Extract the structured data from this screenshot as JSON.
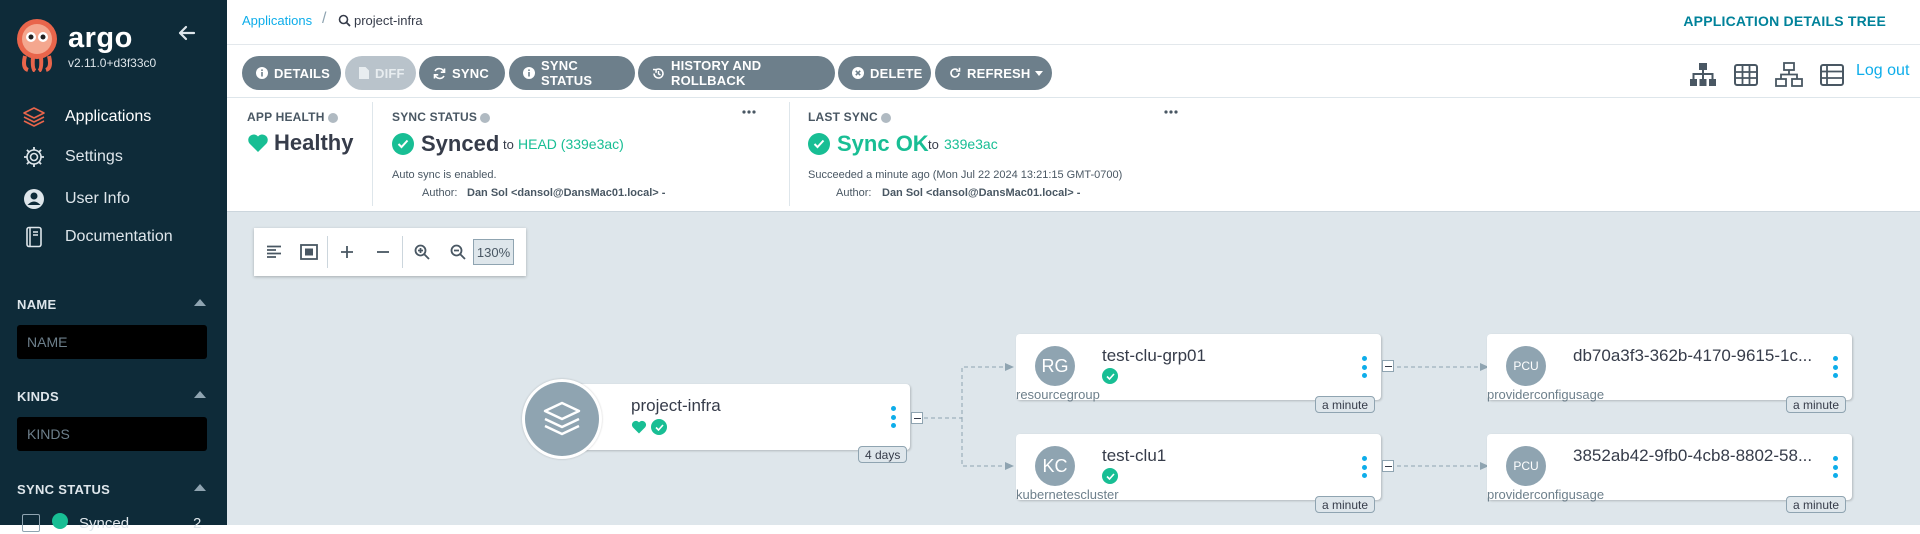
{
  "sidebar": {
    "brand": "argo",
    "version": "v2.11.0+d3f33c0",
    "nav": [
      {
        "label": "Applications",
        "icon": "layers-icon"
      },
      {
        "label": "Settings",
        "icon": "gear-icon"
      },
      {
        "label": "User Info",
        "icon": "user-icon"
      },
      {
        "label": "Documentation",
        "icon": "book-icon"
      }
    ],
    "filters": {
      "name_label": "NAME",
      "name_placeholder": "NAME",
      "kinds_label": "KINDS",
      "kinds_placeholder": "KINDS",
      "sync_status_label": "SYNC STATUS",
      "synced_label": "Synced",
      "synced_count": "2"
    }
  },
  "topbar": {
    "crumb_root": "Applications",
    "crumb_app": "project-infra",
    "page_title": "APPLICATION DETAILS TREE"
  },
  "toolbar": {
    "details": "DETAILS",
    "diff": "DIFF",
    "sync": "SYNC",
    "sync_status": "SYNC STATUS",
    "history": "HISTORY AND ROLLBACK",
    "delete": "DELETE",
    "refresh": "REFRESH",
    "logout": "Log out"
  },
  "status": {
    "health_label": "APP HEALTH",
    "health_value": "Healthy",
    "sync_label": "SYNC STATUS",
    "sync_value": "Synced",
    "sync_to": "to",
    "sync_target": "HEAD (339e3ac)",
    "auto_sync": "Auto sync is enabled.",
    "author_label": "Author:",
    "author": "Dan Sol <dansol@DansMac01.local> -",
    "last_sync_label": "LAST SYNC",
    "last_sync_value": "Sync OK",
    "last_sync_to": "to",
    "last_sync_rev": "339e3ac",
    "succeeded": "Succeeded a minute ago (Mon Jul 22 2024 13:21:15 GMT-0700)",
    "last_author_label": "Author:",
    "last_author": "Dan Sol <dansol@DansMac01.local> -"
  },
  "zoom": {
    "level": "130%"
  },
  "tree": {
    "app": {
      "name": "project-infra",
      "age": "4 days"
    },
    "nodes": [
      {
        "abbr": "RG",
        "name": "test-clu-grp01",
        "kind": "resourcegroup",
        "age": "a minute"
      },
      {
        "abbr": "KC",
        "name": "test-clu1",
        "kind": "kubernetescluster",
        "age": "a minute"
      },
      {
        "abbr": "PCU",
        "name": "db70a3f3-362b-4170-9615-1c...",
        "kind": "providerconfigusage",
        "age": "a minute"
      },
      {
        "abbr": "PCU",
        "name": "3852ab42-9fb0-4cb8-8802-58...",
        "kind": "providerconfigusage",
        "age": "a minute"
      }
    ]
  },
  "colors": {
    "accent": "#18be94",
    "link": "#0dadea",
    "sidebar": "#0e2b39",
    "canvas": "#dee6eb",
    "button": "#6d7f8b"
  }
}
